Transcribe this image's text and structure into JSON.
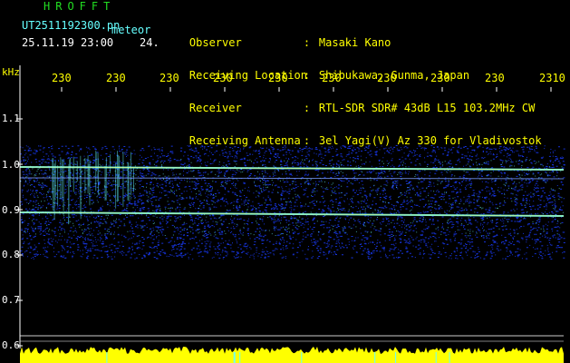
{
  "header": {
    "brand": "HROFFT",
    "filename": "UT2511192300.pn",
    "tag": "meteor",
    "datetime": "25.11.19 23:00    24."
  },
  "info": [
    {
      "label": "Observer",
      "value": "Masaki Kano"
    },
    {
      "label": "Receiving Location",
      "value": "Shibukawa, Gunma, Japan"
    },
    {
      "label": "Receiver",
      "value": "RTL-SDR SDR# 43dB L15 103.2MHz CW"
    },
    {
      "label": "Receiving Antenna",
      "value": "3el Yagi(V) Az 330 for Vladivostok"
    }
  ],
  "y_unit": "kHz",
  "y_ticks": [
    "1.1",
    "1.0",
    "0.9",
    "0.8",
    "0.7",
    "0.6"
  ],
  "x_ticks": [
    "230",
    "230",
    "230",
    "230",
    "230",
    "230",
    "230",
    "230",
    "230",
    "2310"
  ],
  "colors": {
    "label_yellow": "#ffff00",
    "text_white": "#ffffff",
    "brand_green": "#22dd22",
    "signal_cyan": "#66ffff",
    "noise_blue": "#1a3cff",
    "background": "#000000"
  }
}
